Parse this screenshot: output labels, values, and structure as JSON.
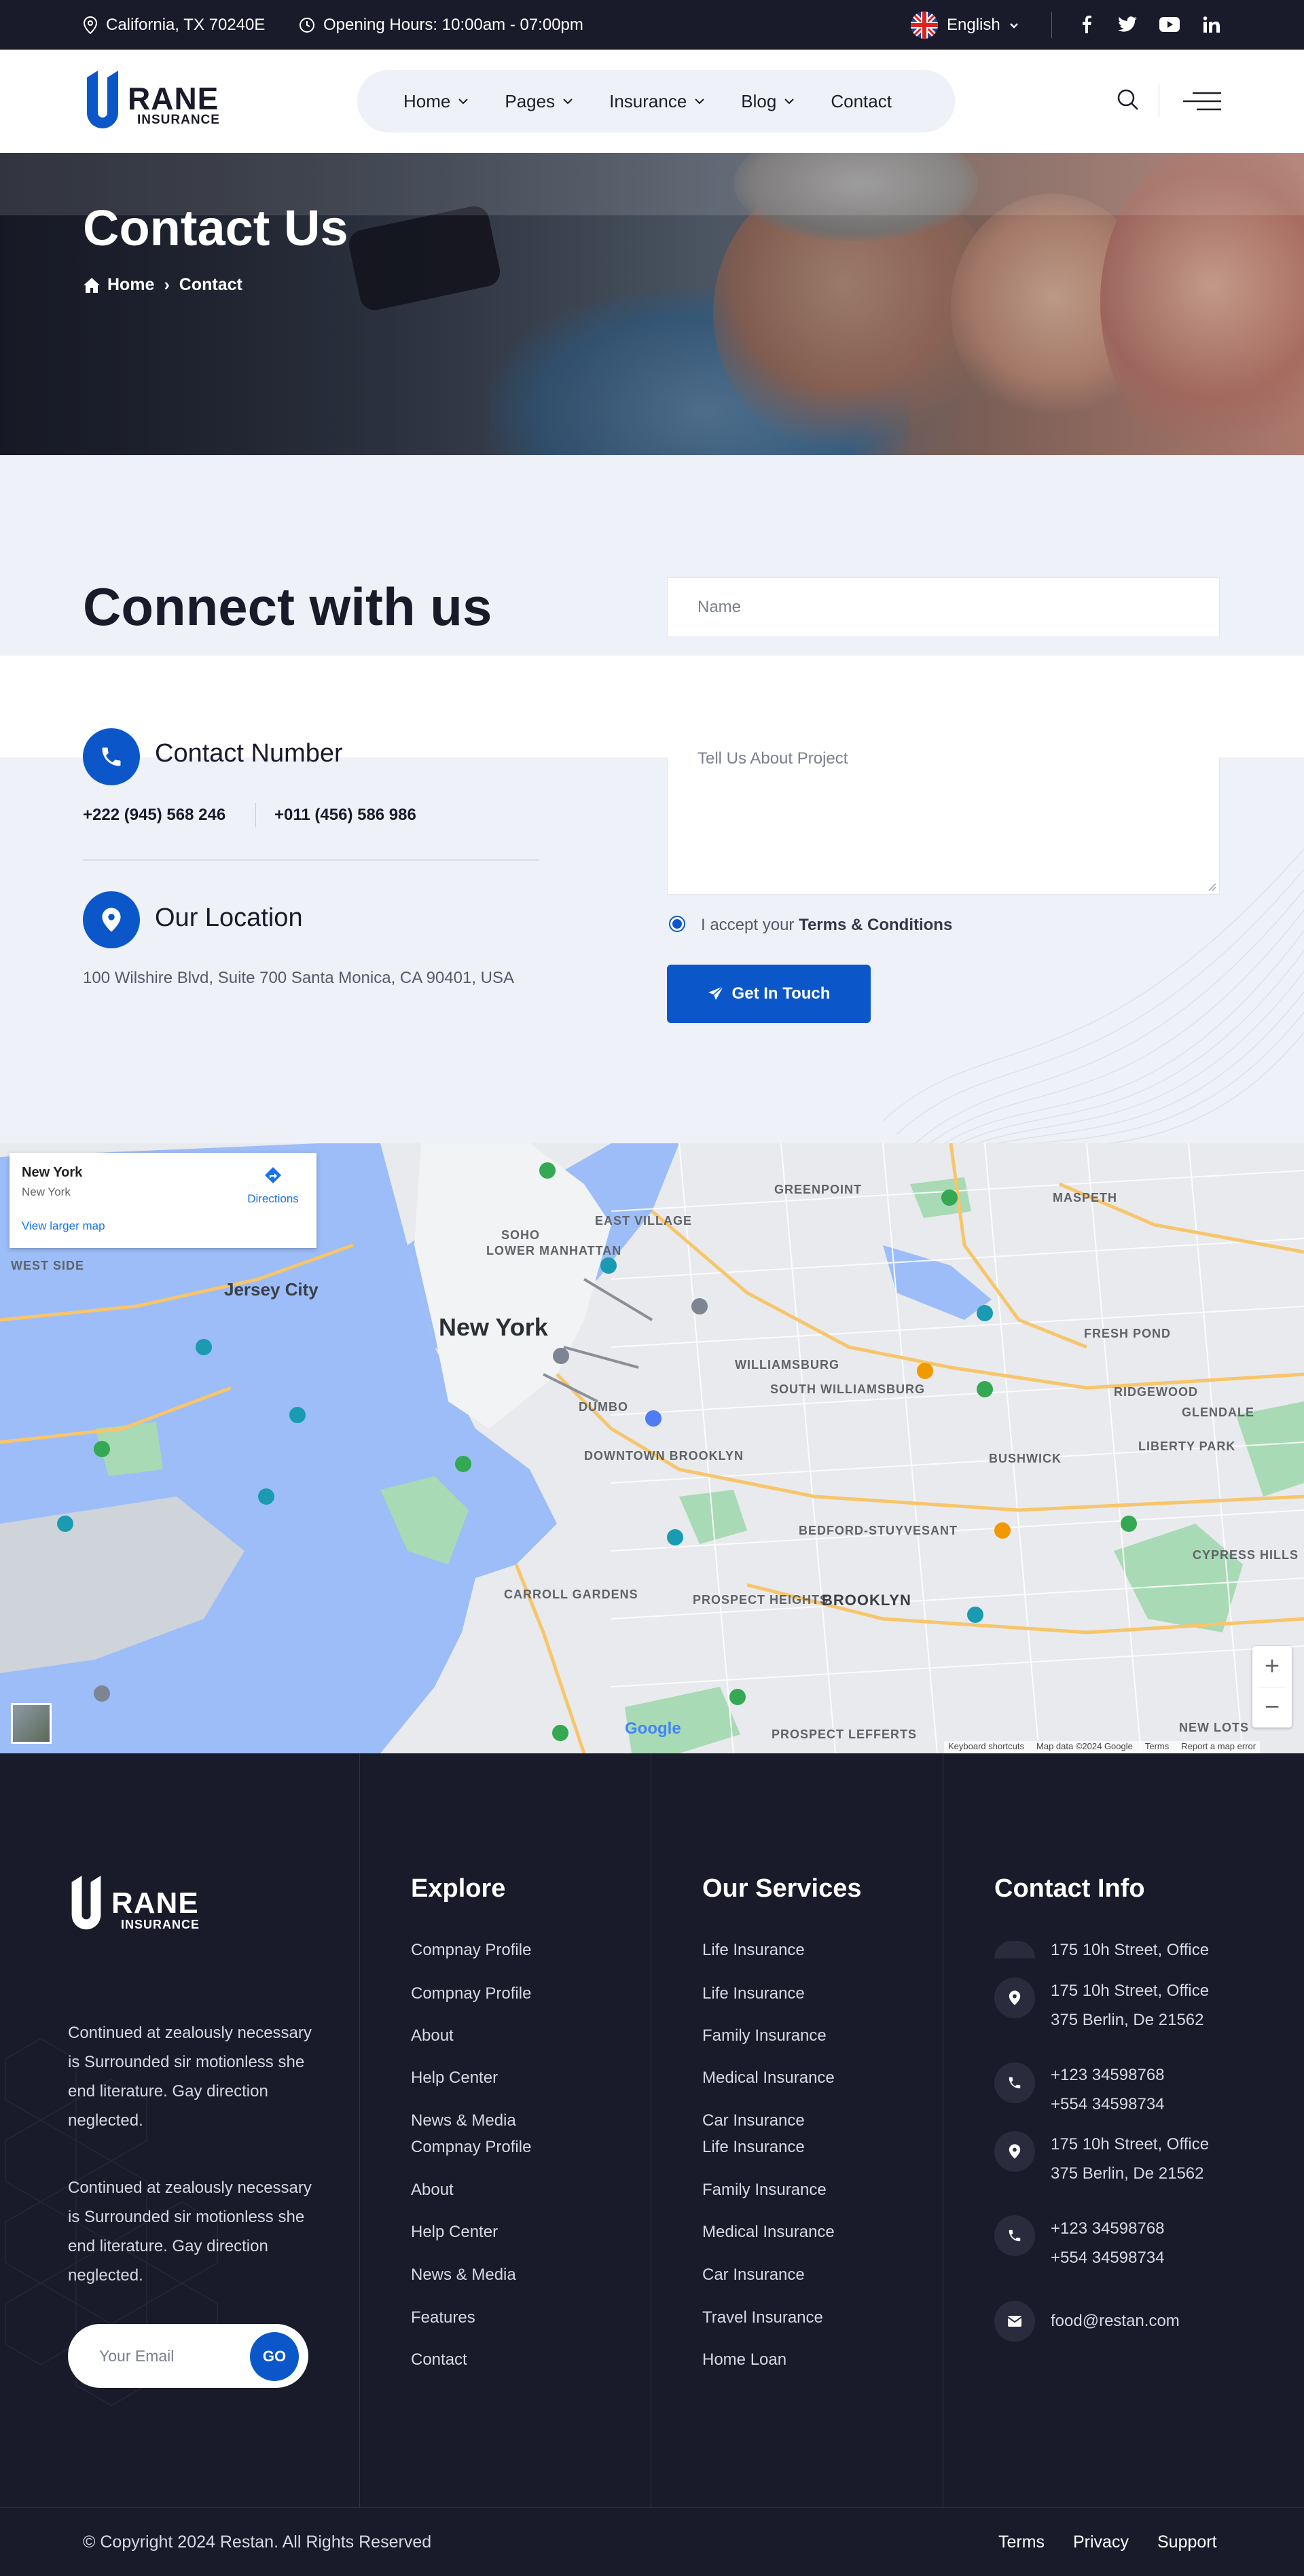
{
  "topbar": {
    "address": "California, TX 70240E",
    "hours": "Opening Hours: 10:00am - 07:00pm",
    "language": "English",
    "social_icons": [
      "facebook-icon",
      "twitter-icon",
      "youtube-icon",
      "linkedin-icon"
    ]
  },
  "brand": {
    "logo_letter": "U",
    "logo_name": "RANE",
    "logo_sub": "INSURANCE",
    "accent": "#0b57c9",
    "dark": "#191a2a"
  },
  "nav": {
    "items": [
      {
        "label": "Home",
        "dropdown": true
      },
      {
        "label": "Pages",
        "dropdown": true
      },
      {
        "label": "Insurance",
        "dropdown": true
      },
      {
        "label": "Blog",
        "dropdown": true
      },
      {
        "label": "Contact",
        "dropdown": false
      }
    ]
  },
  "hero": {
    "title": "Contact Us",
    "breadcrumb_home": "Home",
    "breadcrumb_sep": "›",
    "breadcrumb_current": "Contact"
  },
  "contact": {
    "heading": "Connect with us",
    "number_title": "Contact Number",
    "phone1": "+222 (945) 568 246",
    "phone2": "+011 (456) 586 986",
    "location_title": "Our Location",
    "location_address": "100 Wilshire Blvd, Suite 700 Santa Monica, CA 90401, USA",
    "form": {
      "name_placeholder": "Name",
      "message_placeholder": "Tell Us About Project",
      "accept_text": "I accept your",
      "terms_text": "Terms & Conditions",
      "submit_label": "Get In Touch"
    }
  },
  "map": {
    "card_title": "New York",
    "card_subtitle": "New York",
    "directions_label": "Directions",
    "larger_map_label": "View larger map",
    "city_label": "New York",
    "places": [
      "GREENPOINT",
      "MASPETH",
      "EAST VILLAGE",
      "SOHO",
      "LOWER MANHATTAN",
      "WEST SIDE",
      "Jersey City",
      "WILLIAMSBURG",
      "SOUTH WILLIAMSBURG",
      "FRESH POND",
      "RIDGEWOOD",
      "GLENDALE",
      "BUSHWICK",
      "LIBERTY PARK",
      "DUMBO",
      "DOWNTOWN BROOKLYN",
      "BEDFORD-STUYVESANT",
      "CYPRESS HILLS",
      "CARROLL GARDENS",
      "PROSPECT HEIGHTS",
      "BROOKLYN",
      "NEW LOTS",
      "PROSPECT LEFFERTS"
    ],
    "footer_texts": [
      "Keyboard shortcuts",
      "Map data ©2024 Google",
      "Terms",
      "Report a map error"
    ],
    "zoom_in": "+",
    "zoom_out": "−"
  },
  "footer": {
    "about_text": "Continued at zealously necessary is Surrounded sir motionless she end literature. Gay direction neglected.",
    "email_placeholder": "Your Email",
    "go_label": "GO",
    "explore_title": "Explore",
    "explore_links": [
      "Compnay Profile",
      "Compnay Profile",
      "About",
      "Help Center",
      "News & Media",
      "Compnay Profile",
      "About",
      "Help Center",
      "News & Media",
      "Features",
      "Contact"
    ],
    "services_title": "Our Services",
    "services_links": [
      "Life Insurance",
      "Life Insurance",
      "Family Insurance",
      "Medical Insurance",
      "Car Insurance",
      "Life Insurance",
      "Family Insurance",
      "Medical Insurance",
      "Car Insurance",
      "Travel Insurance",
      "Home Loan"
    ],
    "info_title": "Contact Info",
    "info": {
      "addr_line1": "175 10h Street, Office",
      "addr_line2": "375 Berlin, De 21562",
      "phone1": "+123 34598768",
      "phone2": "+554 34598734",
      "email": "food@restan.com"
    },
    "copyright": "© Copyright 2024 Restan. All Rights Reserved",
    "bottom_links": [
      "Terms",
      "Privacy",
      "Support"
    ]
  }
}
